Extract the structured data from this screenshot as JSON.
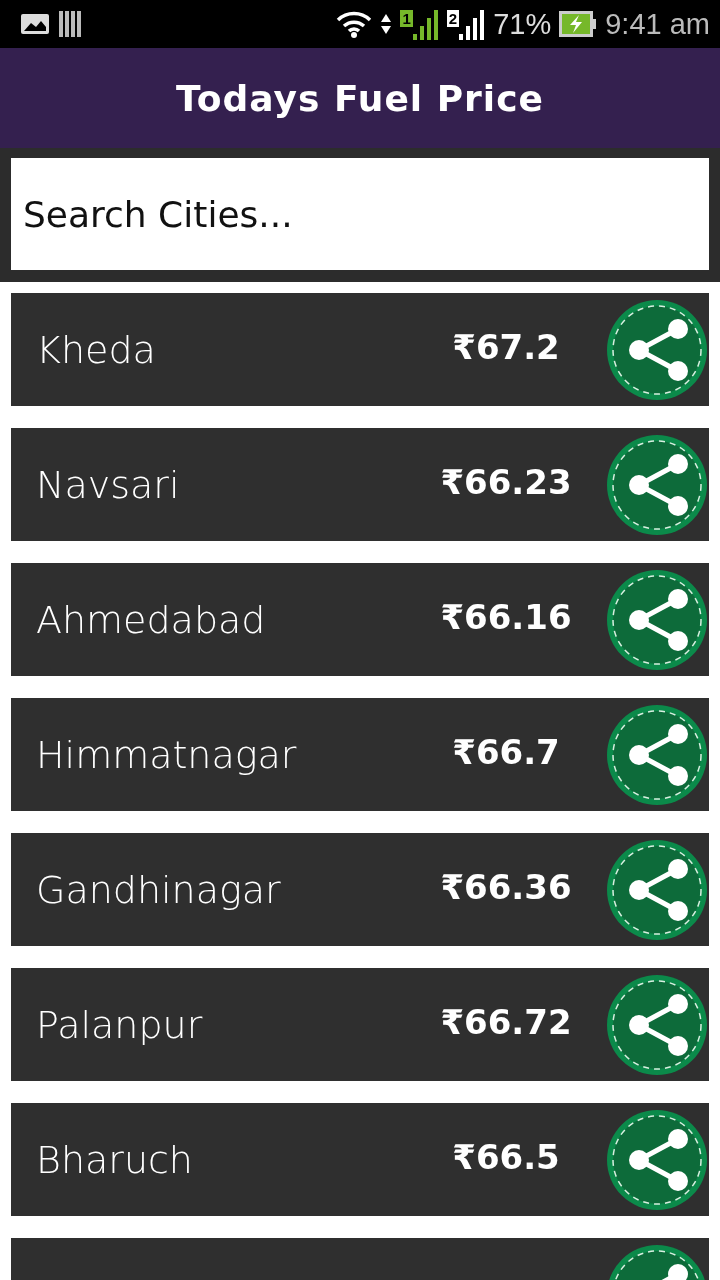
{
  "status_bar": {
    "battery": "71%",
    "time": "9:41 am",
    "sims": [
      {
        "label": "1",
        "color": "#76b82a"
      },
      {
        "label": "2",
        "color": "#ffffff"
      }
    ]
  },
  "header": {
    "title": "Todays Fuel Price"
  },
  "search": {
    "placeholder": "Search Cities..."
  },
  "rows": [
    {
      "kind": "full",
      "city": "Kheda",
      "price": "₹67.2"
    },
    {
      "kind": "full",
      "city": "Navsari",
      "price": "₹66.23"
    },
    {
      "kind": "full",
      "city": "Ahmedabad",
      "price": "₹66.16"
    },
    {
      "kind": "full",
      "city": "Himmatnagar",
      "price": "₹66.7"
    },
    {
      "kind": "full",
      "city": "Gandhinagar",
      "price": "₹66.36"
    },
    {
      "kind": "full",
      "city": "Palanpur",
      "price": "₹66.72"
    },
    {
      "kind": "full",
      "city": "Bharuch",
      "price": "₹66.5"
    },
    {
      "kind": "partial"
    }
  ]
}
